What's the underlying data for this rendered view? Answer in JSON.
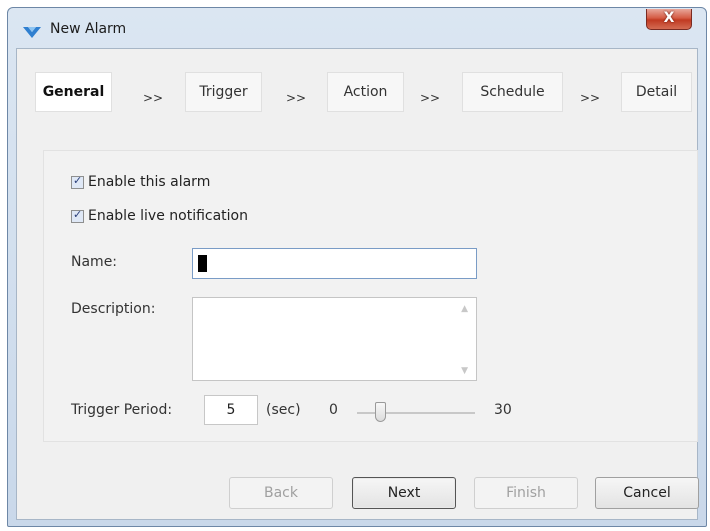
{
  "window": {
    "title": "New Alarm",
    "close_label": "X"
  },
  "steps": [
    {
      "label": "General"
    },
    {
      "label": "Trigger"
    },
    {
      "label": "Action"
    },
    {
      "label": "Schedule"
    },
    {
      "label": "Detail"
    }
  ],
  "arrows": [
    ">>",
    ">>",
    ">>",
    ">>"
  ],
  "options": {
    "enable_alarm": {
      "label": "Enable this alarm",
      "checked": true
    },
    "enable_live_notification": {
      "label": "Enable live notification",
      "checked": true
    }
  },
  "fields": {
    "name_label": "Name:",
    "name_value": "",
    "description_label": "Description:",
    "description_value": "",
    "trigger_period_label": "Trigger Period:",
    "trigger_period_value": "5",
    "trigger_period_unit": "(sec)",
    "slider_min": "0",
    "slider_max": "30",
    "slider_value": 5
  },
  "buttons": {
    "back": "Back",
    "next": "Next",
    "finish": "Finish",
    "cancel": "Cancel"
  },
  "colors": {
    "frame": "#c9d8ea",
    "close": "#c13a22",
    "focus_border": "#7a9cc6"
  }
}
